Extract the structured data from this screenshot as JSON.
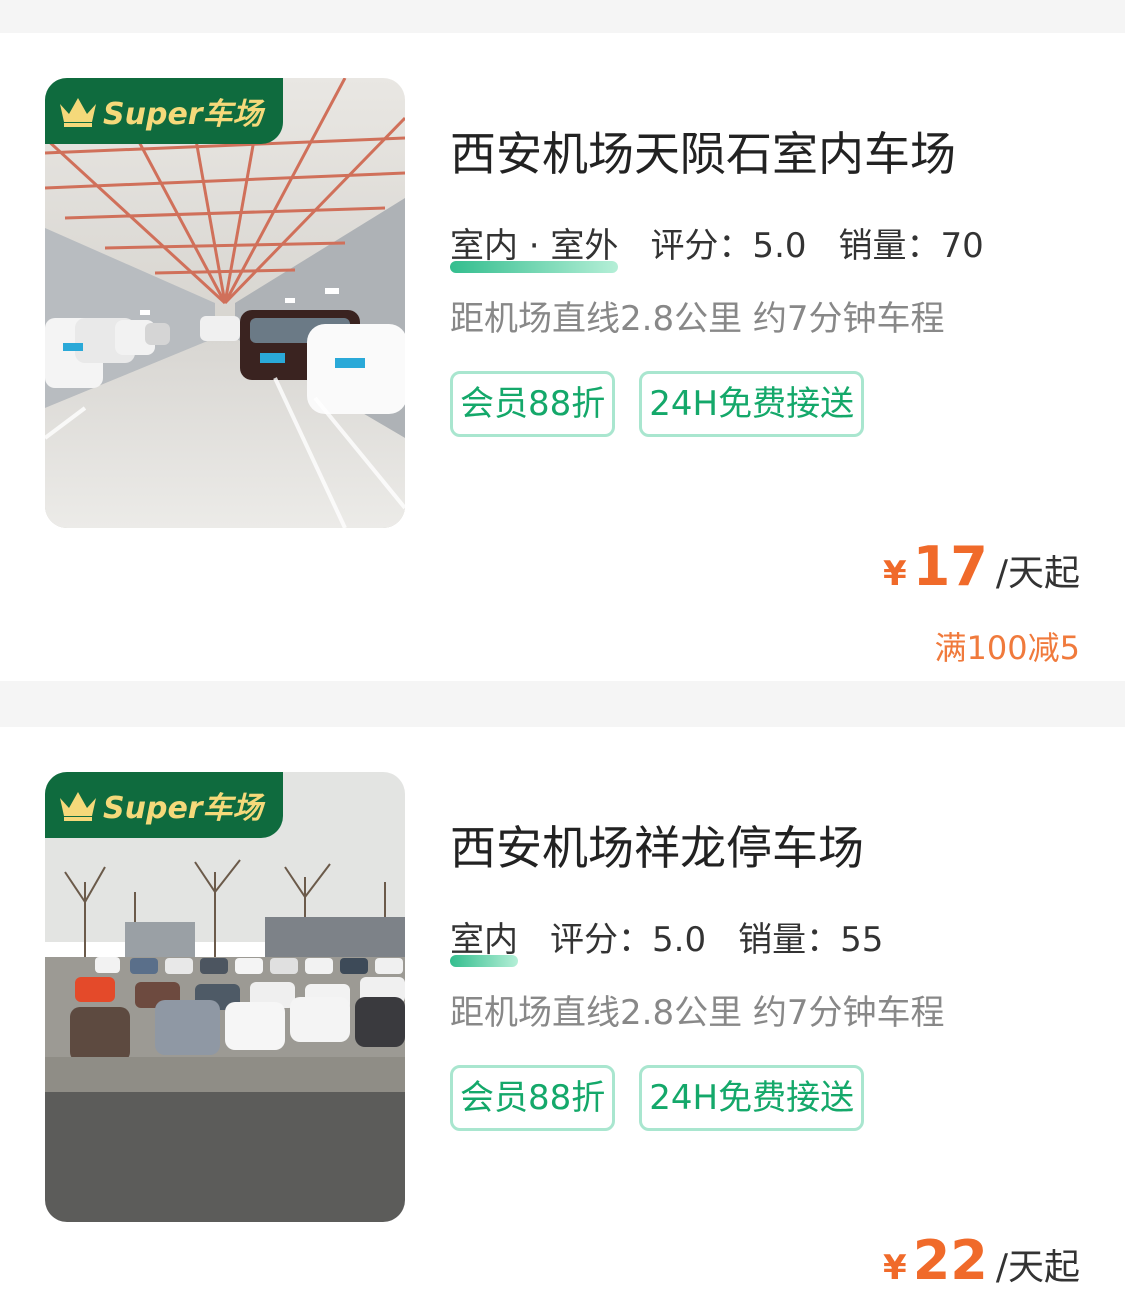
{
  "colors": {
    "accent_green": "#14a86a",
    "price_orange": "#f06a2a",
    "badge_green": "#0f6b3e",
    "badge_text": "#f5d97a"
  },
  "lots": [
    {
      "badge_text": "Super车场",
      "name": "西安机场天陨石室内车场",
      "location_type": "室内 · 室外",
      "rating": "评分：5.0",
      "sales": "销量：70",
      "distance": "距机场直线2.8公里 约7分钟车程",
      "tags": [
        "会员88折",
        "24H免费接送"
      ],
      "currency": "¥",
      "price": "17",
      "unit": "/天起",
      "promo": "满100减5",
      "photo": "indoor-parking-garage-photo"
    },
    {
      "badge_text": "Super车场",
      "name": "西安机场祥龙停车场",
      "location_type": "室内",
      "rating": "评分：5.0",
      "sales": "销量：55",
      "distance": "距机场直线2.8公里 约7分钟车程",
      "tags": [
        "会员88折",
        "24H免费接送"
      ],
      "currency": "¥",
      "price": "22",
      "unit": "/天起",
      "photo": "outdoor-parking-lot-photo"
    }
  ]
}
